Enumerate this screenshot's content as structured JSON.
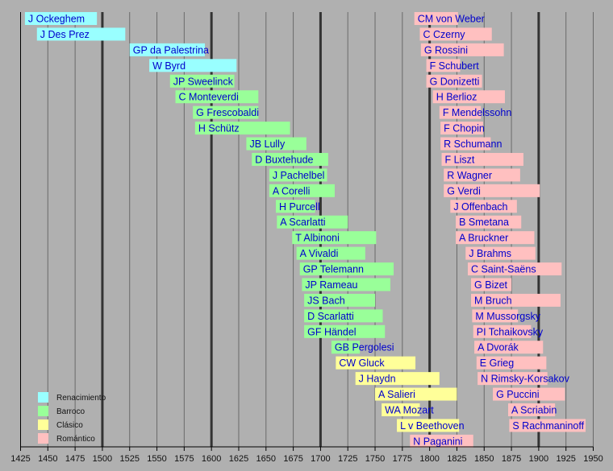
{
  "chart_data": {
    "type": "timeline",
    "title": "",
    "xlabel": "",
    "ylabel": "",
    "xlim": [
      1425,
      1950
    ],
    "x_ticks": [
      1425,
      1450,
      1475,
      1500,
      1525,
      1550,
      1575,
      1600,
      1625,
      1650,
      1675,
      1700,
      1725,
      1750,
      1775,
      1800,
      1825,
      1850,
      1875,
      1900,
      1925,
      1950
    ],
    "major_gridlines": [
      1500,
      1600,
      1700,
      1800,
      1900
    ],
    "grid": true,
    "legend_position": "bottom-left",
    "periods": [
      {
        "key": "renacimiento",
        "label": "Renacimiento",
        "color": "#99ffff"
      },
      {
        "key": "barroco",
        "label": "Barroco",
        "color": "#99ff99"
      },
      {
        "key": "clasico",
        "label": "Clásico",
        "color": "#ffff99"
      },
      {
        "key": "romantico",
        "label": "Romántico",
        "color": "#ffc0c0"
      }
    ],
    "label_color": "#0000cc",
    "columns": [
      [
        {
          "name": "J Ockeghem",
          "start": 1429,
          "end": 1495,
          "period": "renacimiento"
        },
        {
          "name": "J Des Prez",
          "start": 1440,
          "end": 1521,
          "period": "renacimiento"
        },
        {
          "name": "GP da Palestrina",
          "start": 1525,
          "end": 1594,
          "period": "renacimiento"
        },
        {
          "name": "W Byrd",
          "start": 1543,
          "end": 1623,
          "period": "renacimiento"
        },
        {
          "name": "JP Sweelinck",
          "start": 1562,
          "end": 1621,
          "period": "barroco"
        },
        {
          "name": "C Monteverdi",
          "start": 1567,
          "end": 1643,
          "period": "barroco"
        },
        {
          "name": "G Frescobaldi",
          "start": 1583,
          "end": 1643,
          "period": "barroco"
        },
        {
          "name": "H Schütz",
          "start": 1585,
          "end": 1672,
          "period": "barroco"
        },
        {
          "name": "JB Lully",
          "start": 1632,
          "end": 1687,
          "period": "barroco"
        },
        {
          "name": "D Buxtehude",
          "start": 1637,
          "end": 1707,
          "period": "barroco"
        },
        {
          "name": "J Pachelbel",
          "start": 1653,
          "end": 1706,
          "period": "barroco"
        },
        {
          "name": "A Corelli",
          "start": 1653,
          "end": 1713,
          "period": "barroco"
        },
        {
          "name": "H Purcell",
          "start": 1659,
          "end": 1695,
          "period": "barroco"
        },
        {
          "name": "A Scarlatti",
          "start": 1660,
          "end": 1725,
          "period": "barroco"
        },
        {
          "name": "T Albinoni",
          "start": 1674,
          "end": 1751,
          "period": "barroco"
        },
        {
          "name": "A Vivaldi",
          "start": 1678,
          "end": 1741,
          "period": "barroco"
        },
        {
          "name": "GP Telemann",
          "start": 1681,
          "end": 1767,
          "period": "barroco"
        },
        {
          "name": "JP Rameau",
          "start": 1683,
          "end": 1764,
          "period": "barroco"
        },
        {
          "name": "JS Bach",
          "start": 1685,
          "end": 1750,
          "period": "barroco"
        },
        {
          "name": "D Scarlatti",
          "start": 1685,
          "end": 1757,
          "period": "barroco"
        },
        {
          "name": "GF Händel",
          "start": 1685,
          "end": 1759,
          "period": "barroco"
        },
        {
          "name": "GB Pergolesi",
          "start": 1710,
          "end": 1736,
          "period": "barroco"
        },
        {
          "name": "CW Gluck",
          "start": 1714,
          "end": 1787,
          "period": "clasico"
        },
        {
          "name": "J Haydn",
          "start": 1732,
          "end": 1809,
          "period": "clasico"
        },
        {
          "name": "A Salieri",
          "start": 1750,
          "end": 1825,
          "period": "clasico"
        },
        {
          "name": "WA Mozart",
          "start": 1756,
          "end": 1791,
          "period": "clasico"
        },
        {
          "name": "L v Beethoven",
          "start": 1770,
          "end": 1827,
          "period": "clasico"
        },
        {
          "name": "N Paganini",
          "start": 1782,
          "end": 1840,
          "period": "romantico"
        }
      ],
      [
        {
          "name": "CM von Weber",
          "start": 1786,
          "end": 1826,
          "period": "romantico"
        },
        {
          "name": "C Czerny",
          "start": 1791,
          "end": 1857,
          "period": "romantico"
        },
        {
          "name": "G Rossini",
          "start": 1792,
          "end": 1868,
          "period": "romantico"
        },
        {
          "name": "F Schubert",
          "start": 1797,
          "end": 1828,
          "period": "romantico"
        },
        {
          "name": "G Donizetti",
          "start": 1797,
          "end": 1848,
          "period": "romantico"
        },
        {
          "name": "H Berlioz",
          "start": 1803,
          "end": 1869,
          "period": "romantico"
        },
        {
          "name": "F Mendelssohn",
          "start": 1809,
          "end": 1847,
          "period": "romantico"
        },
        {
          "name": "F Chopin",
          "start": 1810,
          "end": 1849,
          "period": "romantico"
        },
        {
          "name": "R Schumann",
          "start": 1810,
          "end": 1856,
          "period": "romantico"
        },
        {
          "name": "F Liszt",
          "start": 1811,
          "end": 1886,
          "period": "romantico"
        },
        {
          "name": "R Wagner",
          "start": 1813,
          "end": 1883,
          "period": "romantico"
        },
        {
          "name": "G Verdi",
          "start": 1813,
          "end": 1901,
          "period": "romantico"
        },
        {
          "name": "J Offenbach",
          "start": 1819,
          "end": 1880,
          "period": "romantico"
        },
        {
          "name": "B Smetana",
          "start": 1824,
          "end": 1884,
          "period": "romantico"
        },
        {
          "name": "A Bruckner",
          "start": 1824,
          "end": 1896,
          "period": "romantico"
        },
        {
          "name": "J Brahms",
          "start": 1833,
          "end": 1897,
          "period": "romantico"
        },
        {
          "name": "C Saint-Saëns",
          "start": 1835,
          "end": 1921,
          "period": "romantico"
        },
        {
          "name": "G Bizet",
          "start": 1838,
          "end": 1875,
          "period": "romantico"
        },
        {
          "name": "M Bruch",
          "start": 1838,
          "end": 1920,
          "period": "romantico"
        },
        {
          "name": "M Mussorgsky",
          "start": 1839,
          "end": 1881,
          "period": "romantico"
        },
        {
          "name": "PI Tchaikovsky",
          "start": 1840,
          "end": 1893,
          "period": "romantico"
        },
        {
          "name": "A Dvorák",
          "start": 1841,
          "end": 1904,
          "period": "romantico"
        },
        {
          "name": "E Grieg",
          "start": 1843,
          "end": 1907,
          "period": "romantico"
        },
        {
          "name": "N Rimsky-Korsakov",
          "start": 1844,
          "end": 1908,
          "period": "romantico"
        },
        {
          "name": "G Puccini",
          "start": 1858,
          "end": 1924,
          "period": "romantico"
        },
        {
          "name": "A Scriabin",
          "start": 1872,
          "end": 1915,
          "period": "romantico"
        },
        {
          "name": "S Rachmaninoff",
          "start": 1873,
          "end": 1943,
          "period": "romantico"
        }
      ]
    ]
  }
}
